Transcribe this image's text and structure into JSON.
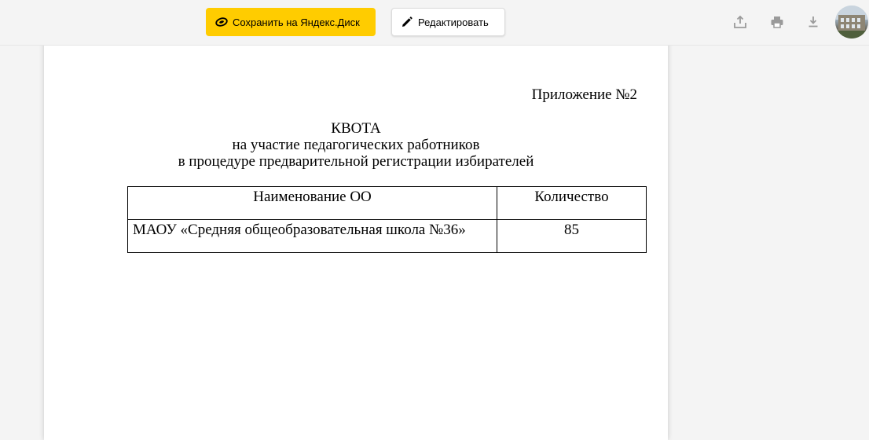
{
  "toolbar": {
    "save_label": "Сохранить на Яндекс.Диск",
    "edit_label": "Редактировать",
    "icons": [
      "yandex-disk-icon",
      "pencil-icon",
      "share-icon",
      "print-icon",
      "download-icon"
    ],
    "accent_color": "#ffcc00"
  },
  "document": {
    "appendix": "Приложение №2",
    "title": "КВОТА",
    "subtitle_line1": "на участие педагогических работников",
    "subtitle_line2": "в процедуре предварительной регистрации избирателей",
    "table": {
      "headers": [
        "Наименование ОО",
        "Количество"
      ],
      "rows": [
        [
          "МАОУ «Средняя общеобразовательная школа №36»",
          "85"
        ]
      ]
    }
  }
}
